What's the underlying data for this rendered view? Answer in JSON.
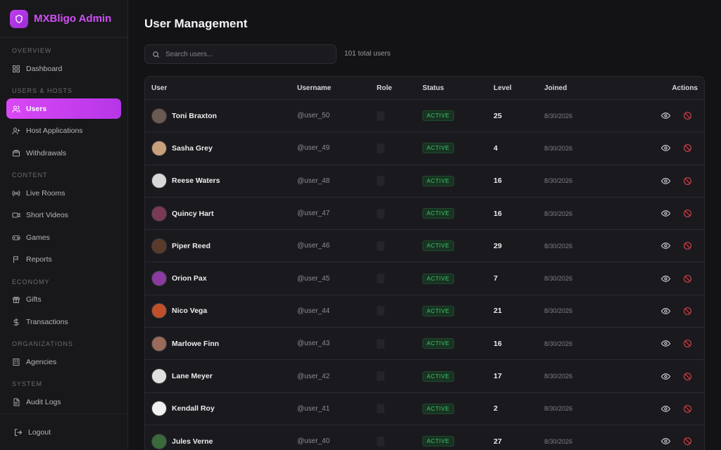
{
  "app": {
    "title": "MXBligo Admin",
    "logo_icon": "shield-icon",
    "accent": "#d24ff5"
  },
  "sidebar": {
    "sections": [
      {
        "label": "OVERVIEW",
        "items": [
          {
            "label": "Dashboard",
            "icon": "grid-icon"
          }
        ]
      },
      {
        "label": "USERS & HOSTS",
        "items": [
          {
            "label": "Users",
            "icon": "users-icon",
            "active": true
          },
          {
            "label": "Host Applications",
            "icon": "user-plus-icon"
          },
          {
            "label": "Withdrawals",
            "icon": "wallet-icon"
          }
        ]
      },
      {
        "label": "CONTENT",
        "items": [
          {
            "label": "Live Rooms",
            "icon": "broadcast-icon"
          },
          {
            "label": "Short Videos",
            "icon": "video-icon"
          },
          {
            "label": "Games",
            "icon": "gamepad-icon"
          },
          {
            "label": "Reports",
            "icon": "flag-icon"
          }
        ]
      },
      {
        "label": "ECONOMY",
        "items": [
          {
            "label": "Gifts",
            "icon": "gift-icon"
          },
          {
            "label": "Transactions",
            "icon": "dollar-icon"
          }
        ]
      },
      {
        "label": "ORGANIZATIONS",
        "items": [
          {
            "label": "Agencies",
            "icon": "building-icon"
          }
        ]
      },
      {
        "label": "SYSTEM",
        "items": [
          {
            "label": "Audit Logs",
            "icon": "document-icon"
          }
        ]
      }
    ],
    "logout_label": "Logout"
  },
  "main": {
    "title": "User Management",
    "search_placeholder": "Search users...",
    "total_users": "101 total users",
    "columns": [
      "User",
      "Username",
      "Role",
      "Status",
      "Level",
      "Joined",
      "Actions"
    ],
    "rows": [
      {
        "name": "Toni Braxton",
        "username": "@user_50",
        "status": "ACTIVE",
        "level": "25",
        "joined": "8/30/2026",
        "avatar_color": "#6b5a52"
      },
      {
        "name": "Sasha Grey",
        "username": "@user_49",
        "status": "ACTIVE",
        "level": "4",
        "joined": "8/30/2026",
        "avatar_color": "#c9a07a"
      },
      {
        "name": "Reese Waters",
        "username": "@user_48",
        "status": "ACTIVE",
        "level": "16",
        "joined": "8/30/2026",
        "avatar_color": "#d8d8d8"
      },
      {
        "name": "Quincy Hart",
        "username": "@user_47",
        "status": "ACTIVE",
        "level": "16",
        "joined": "8/30/2026",
        "avatar_color": "#7a3a55"
      },
      {
        "name": "Piper Reed",
        "username": "@user_46",
        "status": "ACTIVE",
        "level": "29",
        "joined": "8/30/2026",
        "avatar_color": "#5a3a2a"
      },
      {
        "name": "Orion Pax",
        "username": "@user_45",
        "status": "ACTIVE",
        "level": "7",
        "joined": "8/30/2026",
        "avatar_color": "#8a3aa0"
      },
      {
        "name": "Nico Vega",
        "username": "@user_44",
        "status": "ACTIVE",
        "level": "21",
        "joined": "8/30/2026",
        "avatar_color": "#c0502a"
      },
      {
        "name": "Marlowe Finn",
        "username": "@user_43",
        "status": "ACTIVE",
        "level": "16",
        "joined": "8/30/2026",
        "avatar_color": "#9a6a5a"
      },
      {
        "name": "Lane Meyer",
        "username": "@user_42",
        "status": "ACTIVE",
        "level": "17",
        "joined": "8/30/2026",
        "avatar_color": "#e0e0e0"
      },
      {
        "name": "Kendall Roy",
        "username": "@user_41",
        "status": "ACTIVE",
        "level": "2",
        "joined": "8/30/2026",
        "avatar_color": "#f0f0f0"
      },
      {
        "name": "Jules Verne",
        "username": "@user_40",
        "status": "ACTIVE",
        "level": "27",
        "joined": "8/30/2026",
        "avatar_color": "#3a6a3a"
      }
    ],
    "row_actions": [
      {
        "icon": "eye-icon",
        "label": "view"
      },
      {
        "icon": "ban-icon",
        "label": "ban"
      }
    ]
  }
}
